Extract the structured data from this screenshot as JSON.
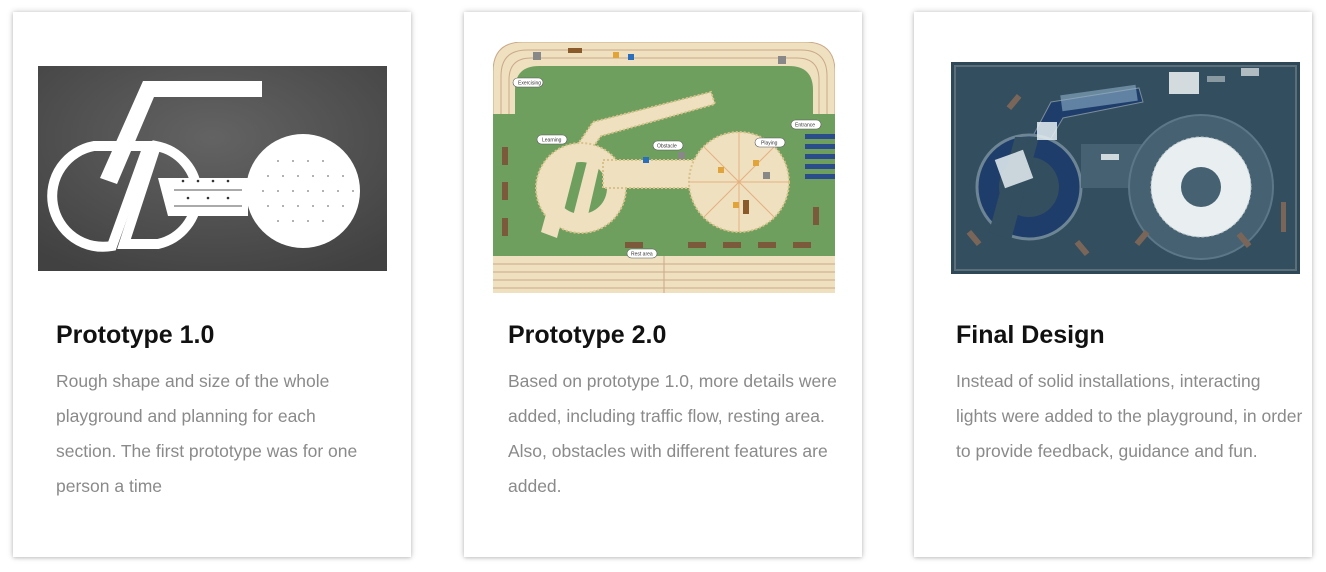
{
  "cards": [
    {
      "title": "Prototype 1.0",
      "description": "Rough shape and size of the whole playground and planning for each section. The first prototype was for one person a time",
      "image": "prototype-1-top-view"
    },
    {
      "title": "Prototype 2.0",
      "description": "Based on prototype 1.0, more details were added, including traffic flow, resting area. Also, obstacles with different features are added.",
      "image": "prototype-2-plan-drawing",
      "labels": {
        "exercising": "Exercising",
        "learning": "Learning",
        "obstacle": "Obstacle",
        "playing": "Playing",
        "entrance": "Entrance",
        "rest": "Rest area"
      }
    },
    {
      "title": "Final Design",
      "description": "Instead of solid installations, interacting lights were added to the playground, in order to provide feedback, guidance and fun.",
      "image": "final-design-render"
    }
  ],
  "colors": {
    "title": "#111111",
    "body_text": "#8a8a8a",
    "proto1_bg": "#505050",
    "proto2_grass": "#6f9f5e",
    "proto2_path": "#efe0c0",
    "final_bg": "#2f4858"
  }
}
